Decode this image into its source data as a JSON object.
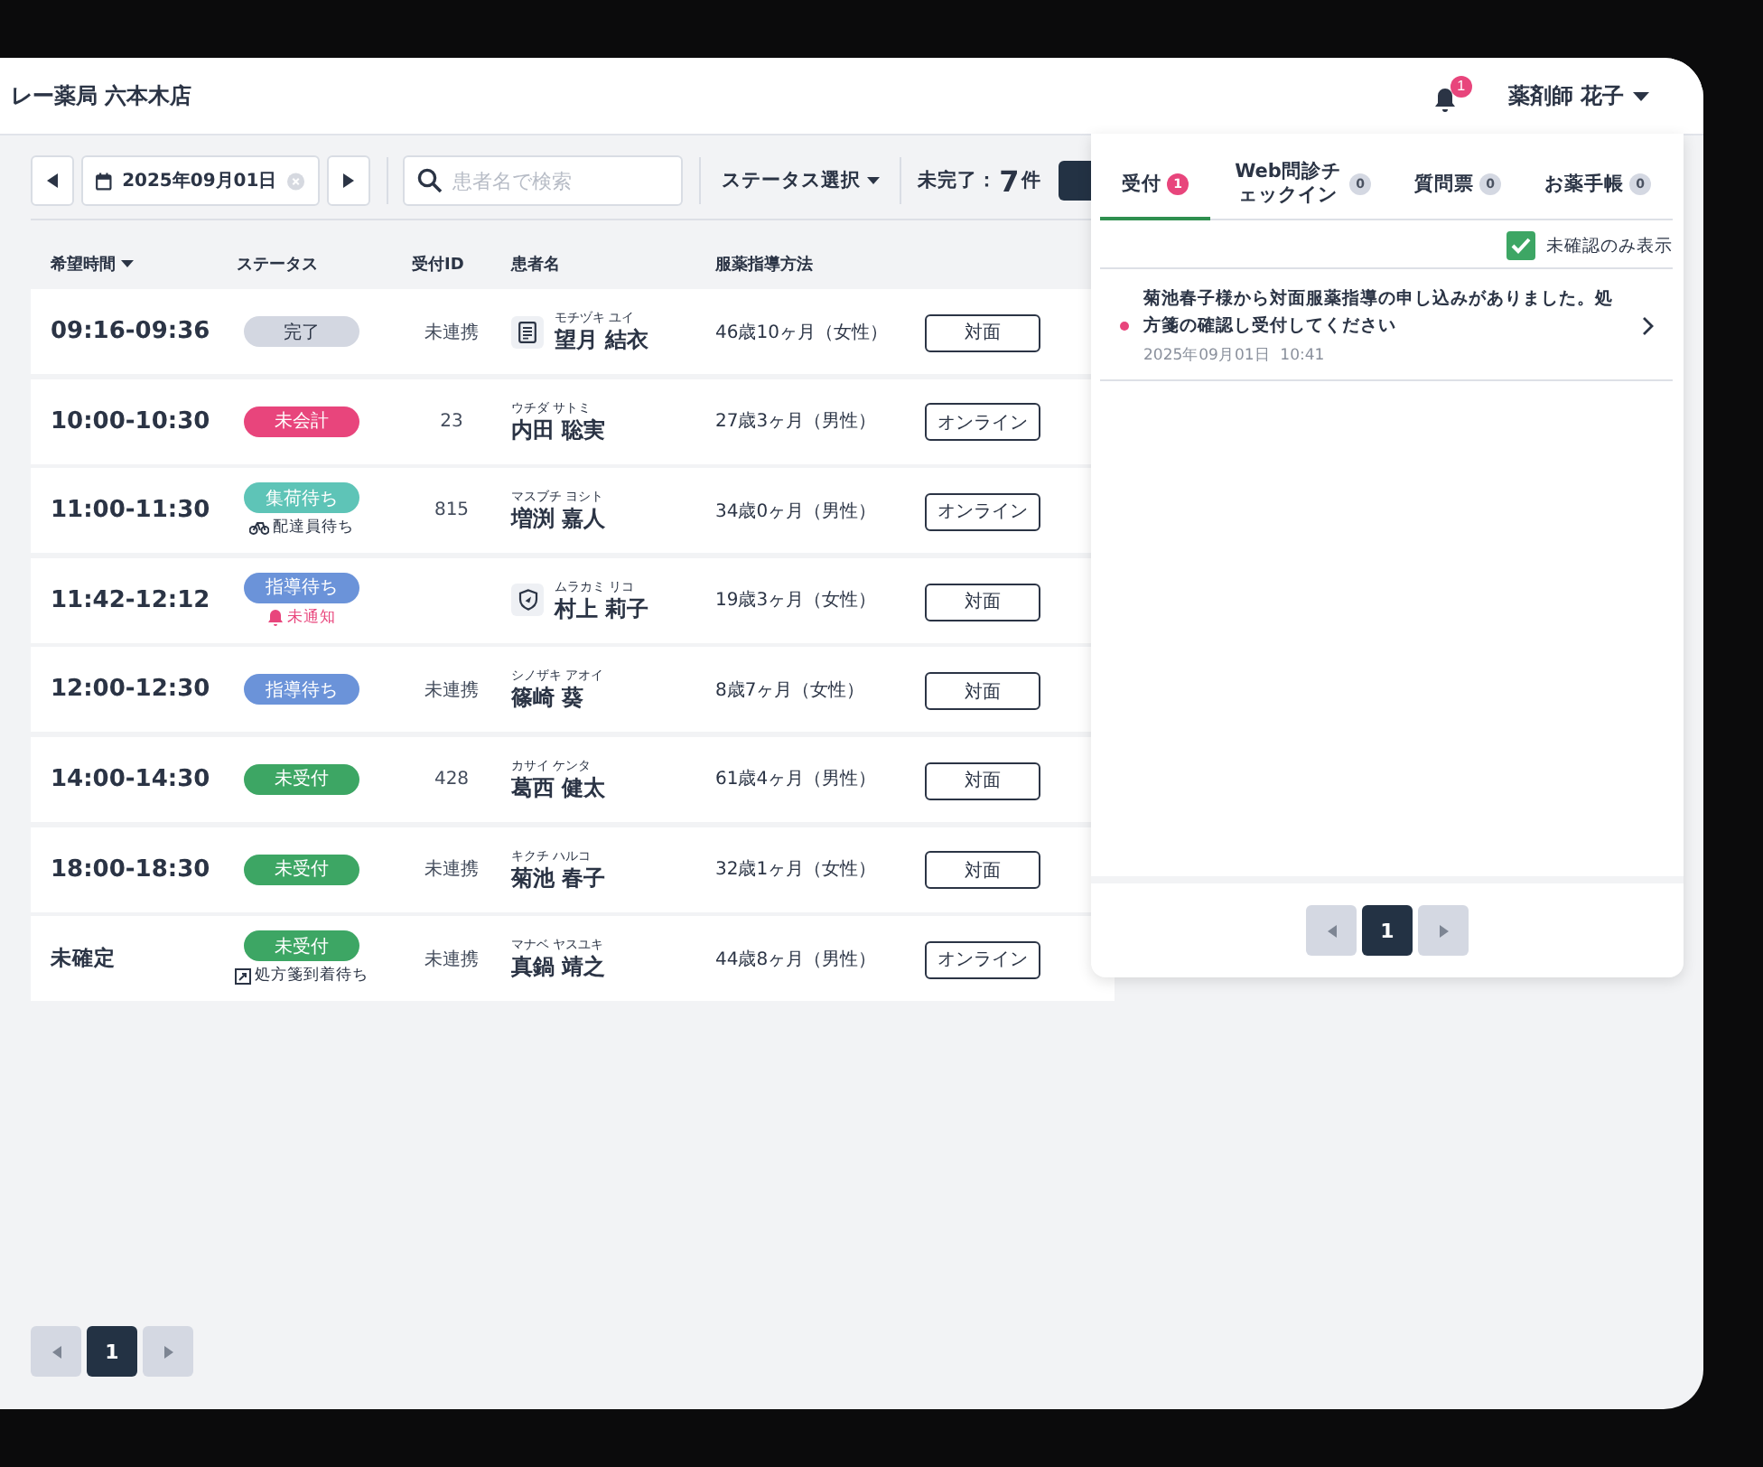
{
  "header": {
    "store_name": "レー薬局 六本木店",
    "notification_count": "1",
    "user": "薬剤師 花子"
  },
  "toolbar": {
    "date": "2025年09月01日",
    "search": {
      "placeholder": "患者名で検索"
    },
    "status_filter": "ステータス選択",
    "remaining_label": "未完了：",
    "remaining_count": "7",
    "remaining_unit": "件"
  },
  "table": {
    "columns": [
      {
        "label": "希望時間",
        "sortable": true
      },
      {
        "label": "ステータス",
        "sortable": false
      },
      {
        "label": "受付ID",
        "sortable": false
      },
      {
        "label": "患者名",
        "sortable": false
      },
      {
        "label": "服薬指導方法",
        "sortable": false
      }
    ],
    "rows": [
      {
        "time": "09:16-09:36",
        "confirmed": true,
        "status": {
          "label": "完了",
          "color": "#d3d7e1"
        },
        "note": null,
        "id": "未連携",
        "kana": "モチヅキ ユイ",
        "name": "望月 結衣",
        "record": {
          "kind": "document"
        },
        "age": "46歳10ヶ月（女性）",
        "method": "対面"
      },
      {
        "time": "10:00-10:30",
        "confirmed": true,
        "status": {
          "label": "未会計",
          "color": "#e8457c"
        },
        "note": null,
        "id": "23",
        "kana": "ウチダ サトミ",
        "name": "内田 聡実",
        "record": null,
        "age": "27歳3ヶ月（男性）",
        "method": "オンライン"
      },
      {
        "time": "11:00-11:30",
        "confirmed": true,
        "status": {
          "label": "集荷待ち",
          "color": "#5ec4b7"
        },
        "note": {
          "kind": "courier",
          "text": "配達員待ち"
        },
        "id": "815",
        "kana": "マスブチ ヨシト",
        "name": "増渕 嘉人",
        "record": null,
        "age": "34歳0ヶ月（男性）",
        "method": "オンライン"
      },
      {
        "time": "11:42-12:12",
        "confirmed": true,
        "status": {
          "label": "指導待ち",
          "color": "#6b93d9"
        },
        "note": {
          "kind": "unnotified",
          "text": "未通知"
        },
        "id": "",
        "kana": "ムラカミ リコ",
        "name": "村上 莉子",
        "record": {
          "kind": "shield"
        },
        "age": "19歳3ヶ月（女性）",
        "method": "対面"
      },
      {
        "time": "12:00-12:30",
        "confirmed": true,
        "status": {
          "label": "指導待ち",
          "color": "#6b93d9"
        },
        "note": null,
        "id": "未連携",
        "kana": "シノザキ アオイ",
        "name": "篠崎 葵",
        "record": null,
        "age": "8歳7ヶ月（女性）",
        "method": "対面"
      },
      {
        "time": "14:00-14:30",
        "confirmed": true,
        "status": {
          "label": "未受付",
          "color": "#3da664"
        },
        "note": null,
        "id": "428",
        "kana": "カサイ ケンタ",
        "name": "葛西 健太",
        "record": null,
        "age": "61歳4ヶ月（男性）",
        "method": "対面"
      },
      {
        "time": "18:00-18:30",
        "confirmed": true,
        "status": {
          "label": "未受付",
          "color": "#3da664"
        },
        "note": null,
        "id": "未連携",
        "kana": "キクチ ハルコ",
        "name": "菊池 春子",
        "record": null,
        "age": "32歳1ヶ月（女性）",
        "method": "対面"
      },
      {
        "time": "未確定",
        "confirmed": false,
        "status": {
          "label": "未受付",
          "color": "#3da664"
        },
        "note": {
          "kind": "prescription",
          "text": "処方箋到着待ち"
        },
        "id": "未連携",
        "kana": "マナベ ヤスユキ",
        "name": "真鍋 靖之",
        "record": null,
        "age": "44歳8ヶ月（男性）",
        "method": "オンライン"
      }
    ]
  },
  "pagination": {
    "page": "1"
  },
  "panel": {
    "tabs": [
      {
        "label": "受付",
        "count": "1",
        "selected": true
      },
      {
        "label": "Web問診チェックイン",
        "count": "0",
        "selected": false
      },
      {
        "label": "質問票",
        "count": "0",
        "selected": false
      },
      {
        "label": "お薬手帳",
        "count": "0",
        "selected": false
      }
    ],
    "filter": {
      "label": "未確認のみ表示",
      "checked": true
    },
    "notifications": [
      {
        "unread": true,
        "message": "菊池春子様から対面服薬指導の申し込みがありました。処方箋の確認し受付してください",
        "date": "2025年09月01日  10:41"
      }
    ],
    "pagination": {
      "page": "1"
    }
  }
}
